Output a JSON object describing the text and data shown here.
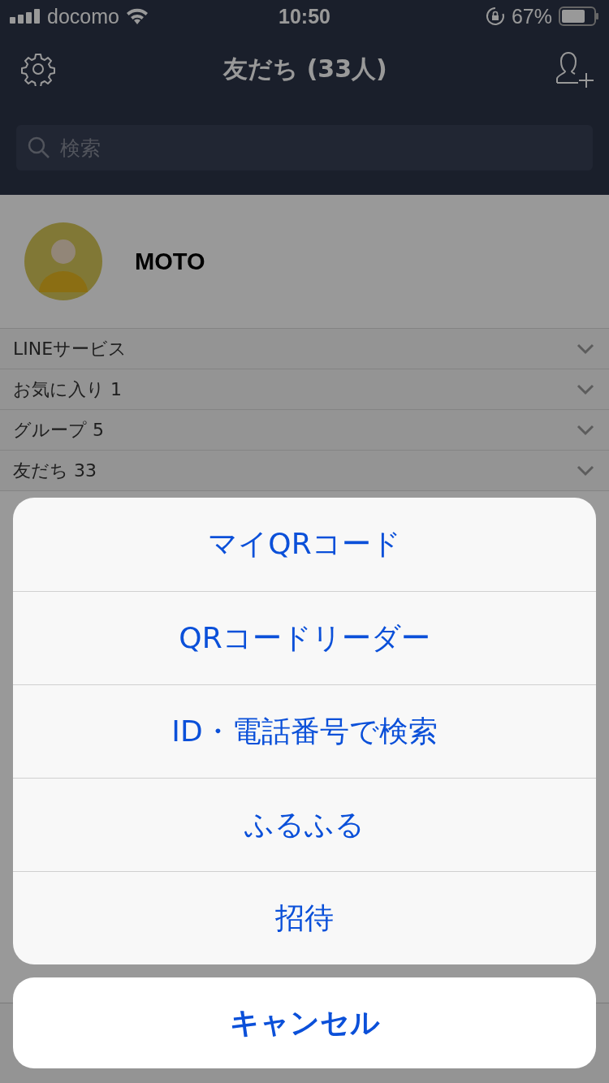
{
  "status_bar": {
    "carrier": "docomo",
    "time": "10:50",
    "battery": "67%"
  },
  "header": {
    "title": "友だち (33人)"
  },
  "search": {
    "placeholder": "検索"
  },
  "profile": {
    "name": "MOTO"
  },
  "sections": [
    {
      "label": "LINEサービス"
    },
    {
      "label": "お気に入り 1"
    },
    {
      "label": "グループ 5"
    },
    {
      "label": "友だち 33"
    }
  ],
  "action_sheet": {
    "options": [
      "マイQRコード",
      "QRコードリーダー",
      "ID・電話番号で検索",
      "ふるふる",
      "招待"
    ],
    "cancel": "キャンセル"
  }
}
